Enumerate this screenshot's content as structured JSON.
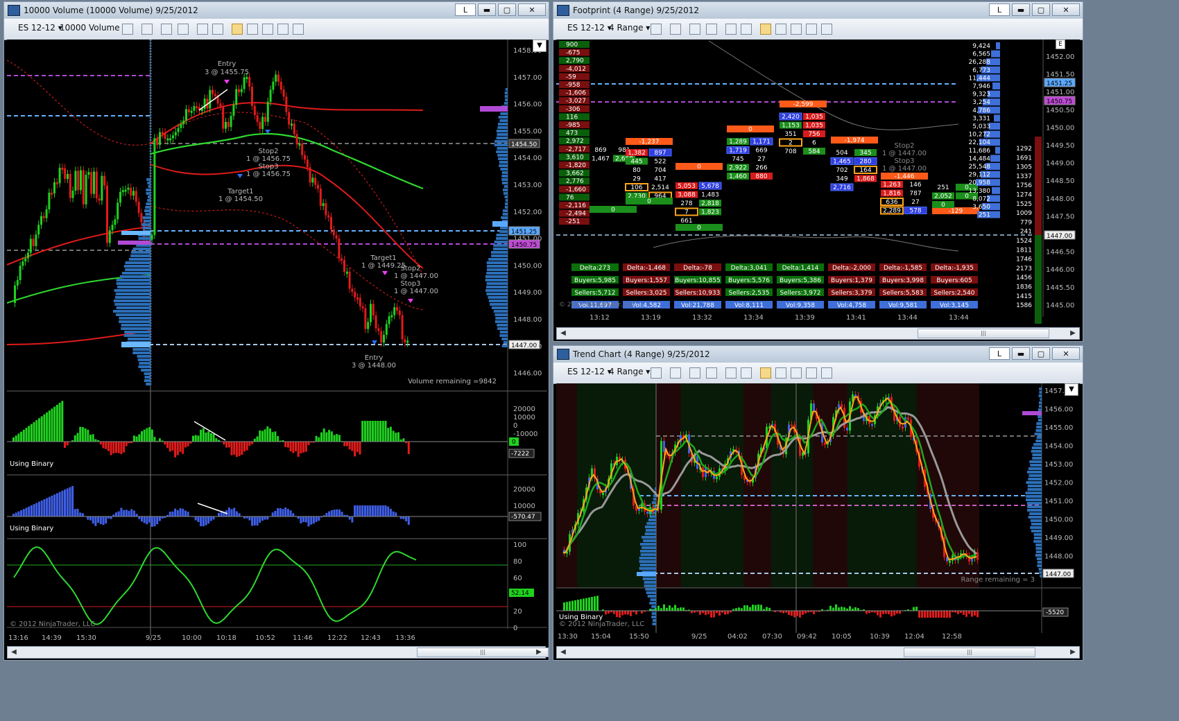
{
  "win1": {
    "title": "10000 Volume (10000 Volume)  9/25/2012",
    "btn_l": "L",
    "instrument": "ES 12-12",
    "period": "10000 Volume",
    "price_ticks": [
      "1458.00",
      "1457.00",
      "1456.00",
      "1455.00",
      "1454.00",
      "1453.00",
      "1452.00",
      "1451.00",
      "1450.00",
      "1449.00",
      "1448.00",
      "1447.00",
      "1446.00"
    ],
    "price_flags": [
      "1454.50",
      "1451.25",
      "1450.75",
      "1447.00"
    ],
    "annotations": {
      "entry_top": "Entry",
      "entry_top_qty": "3 @ 1455.75",
      "stop2": "Stop2",
      "stop2_val": "1 @ 1456.75",
      "stop3": "Stop3",
      "stop3_val": "1 @ 1456.75",
      "target1": "Target1",
      "target1_val": "1 @ 1454.50",
      "target1b": "Target1",
      "target1b_val": "1 @ 1449.25",
      "stop2b": "Stop2",
      "stop2b_val": "1 @ 1447.00",
      "stop3b": "Stop3",
      "stop3b_val": "1 @ 1447.00",
      "entry_bot": "Entry",
      "entry_bot_qty": "3 @ 1448.00"
    },
    "volume_remaining": "Volume remaining =9842",
    "ind1": {
      "label": "Using Binary",
      "ticks": [
        "20000",
        "10000",
        "0",
        "-10000"
      ],
      "flag_zero": "0",
      "flag_val": "-7222"
    },
    "ind2": {
      "label": "Using Binary",
      "ticks": [
        "20000",
        "10000"
      ],
      "flag_val": "-570.47"
    },
    "ind3": {
      "ticks": [
        "100",
        "80",
        "60",
        "40",
        "20",
        "0"
      ],
      "flag_val": "52.14"
    },
    "copyright": "© 2012 NinjaTrader, LLC",
    "time_labels": [
      "13:16",
      "14:39",
      "15:30",
      "9/25",
      "10:00",
      "10:18",
      "10:52",
      "11:46",
      "12:22",
      "12:43",
      "13:36"
    ]
  },
  "win2": {
    "title": "Footprint (4 Range)  9/25/2012",
    "btn_l": "L",
    "instrument": "ES 12-12",
    "period": "4 Range",
    "price_ticks": [
      "1452.00",
      "1451.50",
      "1451.00",
      "1450.50",
      "1450.00",
      "1449.50",
      "1449.00",
      "1448.50",
      "1448.00",
      "1447.50",
      "1447.00",
      "1446.50",
      "1446.00",
      "1445.50",
      "1445.00"
    ],
    "price_flags": [
      "1451.25",
      "1450.75",
      "1447.00"
    ],
    "left_delta": [
      "900",
      "-675",
      "2,790",
      "-4,012",
      "-59",
      "-958",
      "-1,606",
      "-3,027",
      "-306",
      "116",
      "-985",
      "473",
      "2,972",
      "-2,717",
      "3,610",
      "-1,820",
      "3,662",
      "2,776",
      "-1,660",
      "76",
      "-2,116",
      "-2,494",
      "-251"
    ],
    "ladder": [
      "9,424",
      "6,565",
      "26,288",
      "6,773",
      "11,444",
      "7,946",
      "9,323",
      "3,254",
      "4,786",
      "3,331",
      "5,033",
      "10,272",
      "22,104",
      "11,686",
      "14,484",
      "25,548",
      "29,112",
      "20,958",
      "13,380",
      "8,072",
      "3,650",
      "251"
    ],
    "right_vol": [
      "1292",
      "1691",
      "1305",
      "1337",
      "1756",
      "1274",
      "1525",
      "1009",
      "779",
      "241",
      "1524",
      "1811",
      "1746",
      "2173",
      "1456",
      "1836",
      "1415",
      "1586"
    ],
    "columns": [
      {
        "delta": "Delta:273",
        "buyers": "Buyers:5,985",
        "sellers": "Sellers:5,712",
        "vol": "Vol:11,697",
        "time": "13:12"
      },
      {
        "delta": "Delta:-1,468",
        "buyers": "Buyers:1,557",
        "sellers": "Sellers:3,025",
        "vol": "Vol:4,582",
        "time": "13:19"
      },
      {
        "delta": "Delta:-78",
        "buyers": "Buyers:10,855",
        "sellers": "Sellers:10,933",
        "vol": "Vol:21,788",
        "time": "13:32"
      },
      {
        "delta": "Delta:3,041",
        "buyers": "Buyers:5,576",
        "sellers": "Sellers:2,535",
        "vol": "Vol:8,111",
        "time": "13:34"
      },
      {
        "delta": "Delta:1,414",
        "buyers": "Buyers:5,386",
        "sellers": "Sellers:3,972",
        "vol": "Vol:9,358",
        "time": "13:39"
      },
      {
        "delta": "Delta:-2,000",
        "buyers": "Buyers:1,379",
        "sellers": "Sellers:3,379",
        "vol": "Vol:4,758",
        "time": "13:41"
      },
      {
        "delta": "Delta:-1,585",
        "buyers": "Buyers:3,998",
        "sellers": "Sellers:5,583",
        "vol": "Vol:9,581",
        "time": "13:44"
      },
      {
        "delta": "Delta:-1,935",
        "buyers": "Buyers:605",
        "sellers": "Sellers:2,540",
        "vol": "Vol:3,145",
        "time": "13:44"
      }
    ],
    "cells": [
      {
        "t": "-1,237",
        "c": "#ff5a1a"
      },
      {
        "t": "0",
        "c": "#ff5a1a"
      },
      {
        "t": "-2,599",
        "c": "#ff5a1a"
      },
      {
        "t": "0",
        "c": "#ff5a1a"
      },
      {
        "t": "-1,974",
        "c": "#ff5a1a"
      },
      {
        "t": "-1,446",
        "c": "#ff5a1a"
      },
      {
        "t": "-129",
        "c": "#ff5a1a"
      },
      {
        "t": "869",
        "c": "#000"
      },
      {
        "t": "981",
        "c": "#000"
      },
      {
        "t": "1,467",
        "c": "#000"
      },
      {
        "t": "2,668",
        "c": "#1b8f1b"
      },
      {
        "t": "1,382",
        "c": "#d81b1b"
      },
      {
        "t": "897",
        "c": "#2f3fe0"
      },
      {
        "t": "445",
        "c": "#1b8f1b"
      },
      {
        "t": "522",
        "c": "#000"
      },
      {
        "t": "80",
        "c": "#000"
      },
      {
        "t": "704",
        "c": "#000"
      },
      {
        "t": "29",
        "c": "#000"
      },
      {
        "t": "417",
        "c": "#000"
      },
      {
        "t": "106",
        "c": "#e89a10"
      },
      {
        "t": "2,514",
        "c": "#000"
      },
      {
        "t": "2,730",
        "c": "#1b8f1b"
      },
      {
        "t": "964",
        "c": "#e89a10"
      },
      {
        "t": "5,053",
        "c": "#d81b1b"
      },
      {
        "t": "5,678",
        "c": "#2f3fe0"
      },
      {
        "t": "3,088",
        "c": "#d81b1b"
      },
      {
        "t": "1,483",
        "c": "#000"
      },
      {
        "t": "278",
        "c": "#000"
      },
      {
        "t": "2,818",
        "c": "#1b8f1b"
      },
      {
        "t": "7",
        "c": "#e89a10"
      },
      {
        "t": "1,823",
        "c": "#1b8f1b"
      },
      {
        "t": "661",
        "c": "#000"
      },
      {
        "t": "1,289",
        "c": "#1b8f1b"
      },
      {
        "t": "1,171",
        "c": "#2f3fe0"
      },
      {
        "t": "1,719",
        "c": "#2f3fe0"
      },
      {
        "t": "669",
        "c": "#000"
      },
      {
        "t": "745",
        "c": "#000"
      },
      {
        "t": "27",
        "c": "#000"
      },
      {
        "t": "2,922",
        "c": "#1b8f1b"
      },
      {
        "t": "266",
        "c": "#000"
      },
      {
        "t": "1,460",
        "c": "#1b8f1b"
      },
      {
        "t": "880",
        "c": "#d81b1b"
      },
      {
        "t": "2,420",
        "c": "#2f3fe0"
      },
      {
        "t": "1,035",
        "c": "#d81b1b"
      },
      {
        "t": "1,153",
        "c": "#1b8f1b"
      },
      {
        "t": "1,035",
        "c": "#d81b1b"
      },
      {
        "t": "351",
        "c": "#000"
      },
      {
        "t": "756",
        "c": "#d81b1b"
      },
      {
        "t": "2",
        "c": "#e89a10"
      },
      {
        "t": "6",
        "c": "#000"
      },
      {
        "t": "708",
        "c": "#000"
      },
      {
        "t": "584",
        "c": "#1b8f1b"
      },
      {
        "t": "504",
        "c": "#000"
      },
      {
        "t": "345",
        "c": "#1b8f1b"
      },
      {
        "t": "1,465",
        "c": "#2f3fe0"
      },
      {
        "t": "280",
        "c": "#2f3fe0"
      },
      {
        "t": "702",
        "c": "#000"
      },
      {
        "t": "164",
        "c": "#e89a10"
      },
      {
        "t": "349",
        "c": "#000"
      },
      {
        "t": "1,868",
        "c": "#d81b1b"
      },
      {
        "t": "2,716",
        "c": "#2f3fe0"
      },
      {
        "t": "1,263",
        "c": "#d81b1b"
      },
      {
        "t": "146",
        "c": "#000"
      },
      {
        "t": "1,816",
        "c": "#d81b1b"
      },
      {
        "t": "787",
        "c": "#000"
      },
      {
        "t": "636",
        "c": "#e89a10"
      },
      {
        "t": "27",
        "c": "#000"
      },
      {
        "t": "2,289",
        "c": "#e89a10"
      },
      {
        "t": "578",
        "c": "#2f3fe0"
      },
      {
        "t": "251",
        "c": "#000"
      },
      {
        "t": "0",
        "c": "#1b8f1b"
      },
      {
        "t": "2,052",
        "c": "#1b8f1b"
      },
      {
        "t": "0",
        "c": "#1b8f1b"
      },
      {
        "t": "0",
        "c": "#1b8f1b"
      },
      {
        "t": "0",
        "c": "#1b8f1b"
      },
      {
        "t": "0",
        "c": "#1b8f1b"
      },
      {
        "t": "0",
        "c": "#1b8f1b"
      }
    ],
    "annot_stop2": "Stop2",
    "annot_stop2_val": "1 @ 1447.00",
    "annot_stop3": "Stop3",
    "annot_stop3_val": "1 @ 1447.00",
    "copyright": "© 2012 NinjaTrader, LLC"
  },
  "win3": {
    "title": "Trend Chart (4 Range)  9/25/2012",
    "btn_l": "L",
    "instrument": "ES 12-12",
    "period": "4 Range",
    "price_ticks": [
      "1457.00",
      "1456.00",
      "1455.00",
      "1454.00",
      "1453.00",
      "1452.00",
      "1451.00",
      "1450.00",
      "1449.00",
      "1448.00",
      "1447.00"
    ],
    "price_flag": "1447.00",
    "range_remaining": "Range remaining = 3",
    "ind": {
      "label": "Using Binary",
      "flag_val": "-5520"
    },
    "copyright": "© 2012 NinjaTrader, LLC",
    "time_labels": [
      "13:30",
      "15:04",
      "15:50",
      "9/25",
      "04:02",
      "07:30",
      "09:42",
      "10:05",
      "10:39",
      "12:04",
      "12:58"
    ]
  },
  "colors": {
    "up": "#1fd21f",
    "down": "#e21b1b",
    "accent_blue": "#4aa3ff",
    "magenta": "#ff3aff"
  }
}
